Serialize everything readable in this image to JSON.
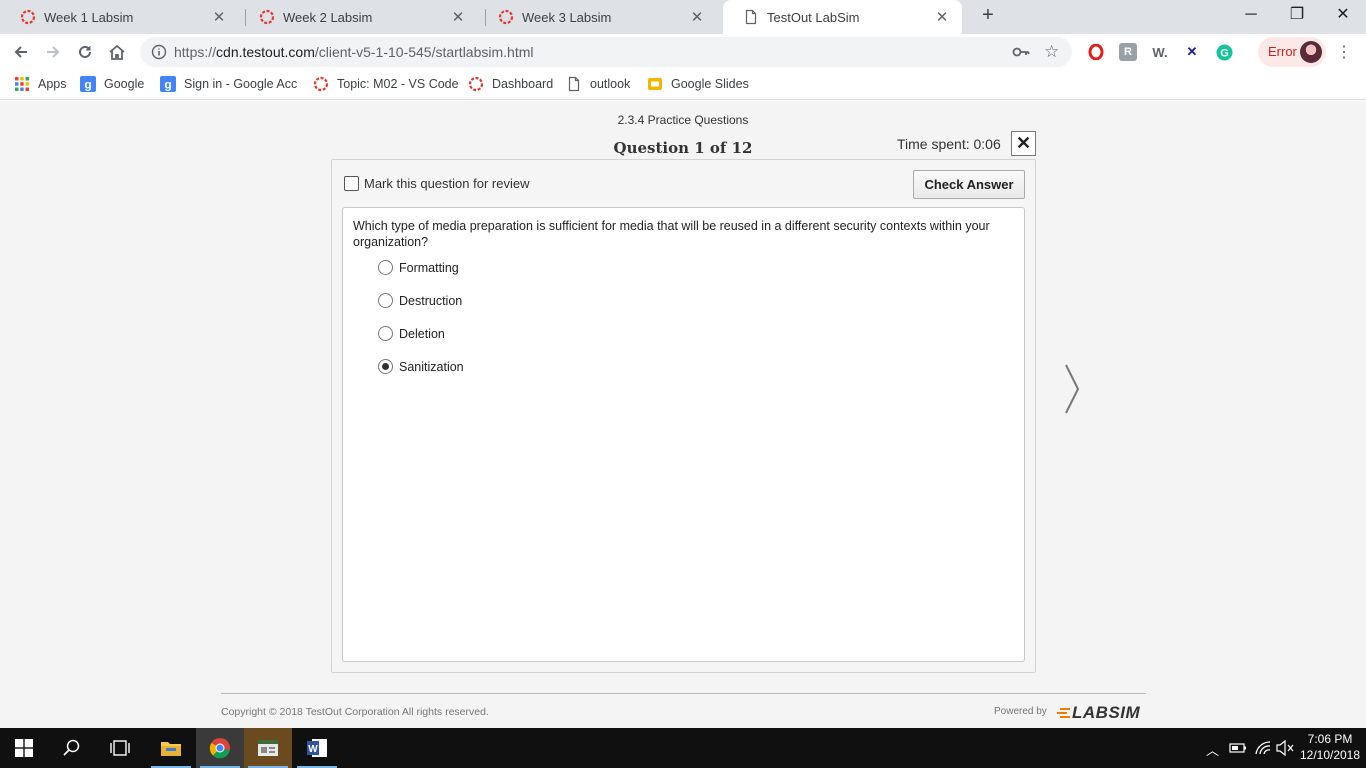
{
  "browser": {
    "tabs": [
      {
        "label": "Week 1 Labsim",
        "icon": "labsim-icon",
        "active": false
      },
      {
        "label": "Week 2 Labsim",
        "icon": "labsim-icon",
        "active": false
      },
      {
        "label": "Week 3 Labsim",
        "icon": "labsim-icon",
        "active": false
      },
      {
        "label": "TestOut LabSim",
        "icon": "page-icon",
        "active": true
      }
    ],
    "url_prefix": "https://",
    "url_host": "cdn.testout.com",
    "url_path": "/client-v5-1-10-545/startlabsim.html",
    "error_label": "Error",
    "bookmarks": [
      {
        "label": "Apps",
        "icon": "apps-grid-icon"
      },
      {
        "label": "Google",
        "icon": "google-icon"
      },
      {
        "label": "Sign in - Google Acc",
        "icon": "google-icon"
      },
      {
        "label": "Topic: M02 - VS Code",
        "icon": "labsim-icon"
      },
      {
        "label": "Dashboard",
        "icon": "labsim-icon"
      },
      {
        "label": "outlook",
        "icon": "page-icon"
      },
      {
        "label": "Google Slides",
        "icon": "slides-icon"
      }
    ]
  },
  "quiz": {
    "section": "2.3.4 Practice Questions",
    "question_counter": "Question 1 of 12",
    "time_spent": "Time spent: 0:06",
    "mark_review_label": "Mark this question for review",
    "check_answer_label": "Check Answer",
    "question_text": "Which type of media preparation is sufficient for media that will be reused in a different security contexts within your organization?",
    "options": [
      {
        "label": "Formatting",
        "selected": false
      },
      {
        "label": "Destruction",
        "selected": false
      },
      {
        "label": "Deletion",
        "selected": false
      },
      {
        "label": "Sanitization",
        "selected": true
      }
    ],
    "copyright": "Copyright © 2018  TestOut Corporation All rights reserved.",
    "powered_by": "Powered by",
    "labsim_logo": "LABSIM"
  },
  "taskbar": {
    "time": "7:06 PM",
    "date": "12/10/2018"
  },
  "colors": {
    "labsim_red": "#e53935",
    "google_blue": "#4285f4",
    "slides_yellow": "#f4b400",
    "page_bg": "#f4f4f4"
  }
}
